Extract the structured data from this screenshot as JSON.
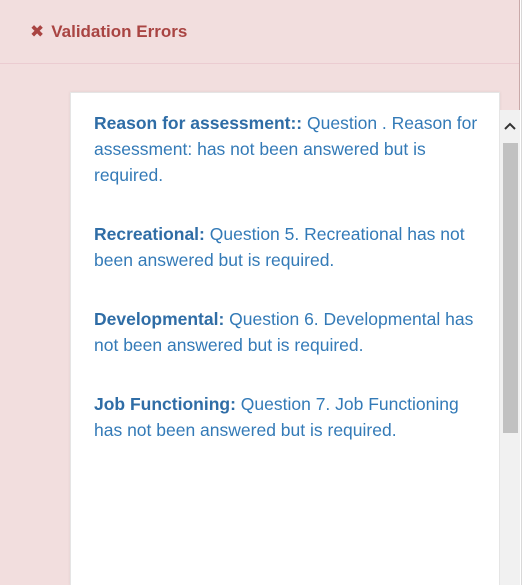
{
  "panel": {
    "icon": "x-icon",
    "title": "Validation Errors"
  },
  "errors": [
    {
      "label": "Reason for assessment::",
      "message": " Question . Reason for assessment: has not been answered but is required."
    },
    {
      "label": "Recreational:",
      "message": " Question 5. Recreational has not been answered but is required."
    },
    {
      "label": "Developmental:",
      "message": " Question 6. Developmental has not been answered but is required."
    },
    {
      "label": "Job Functioning:",
      "message": " Question 7. Job Functioning has not been answered but is required."
    }
  ],
  "scrollbar": {
    "up_icon": "chevron-up-icon",
    "up_glyph": "^"
  },
  "colors": {
    "panel_background": "#f2dede",
    "heading_text": "#a94442",
    "link_text": "#337ab7"
  }
}
